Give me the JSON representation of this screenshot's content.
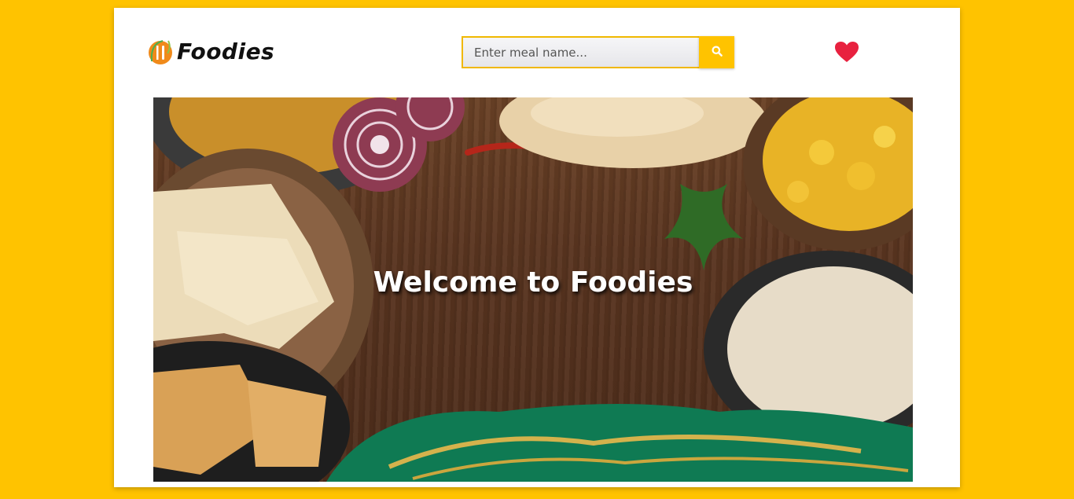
{
  "brand": {
    "name": "Foodies"
  },
  "search": {
    "placeholder": "Enter meal name..."
  },
  "hero": {
    "title": "Welcome to Foodies"
  },
  "colors": {
    "background": "#ffc300",
    "accent": "#ffc300",
    "heart": "#e8213f"
  },
  "icons": {
    "search": "search-icon",
    "favorites": "heart-icon",
    "logo": "fork-knife-icon"
  }
}
